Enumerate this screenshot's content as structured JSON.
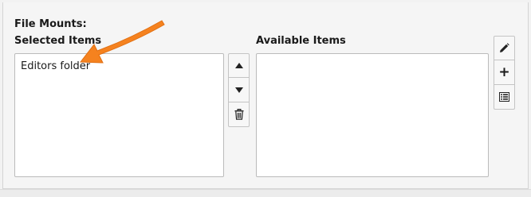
{
  "form": {
    "field_label": "File Mounts:",
    "selected_label": "Selected Items",
    "available_label": "Available Items"
  },
  "selected_items": [
    "Editors folder"
  ],
  "available_items": [],
  "icons": {
    "move_up": "triangle-up-icon",
    "move_down": "triangle-down-icon",
    "delete": "trash-icon",
    "edit": "pencil-icon",
    "add": "plus-icon",
    "list": "list-icon"
  },
  "colors": {
    "annotation_arrow": "#f5821f",
    "panel_bg": "#f5f5f5",
    "list_border": "#bbbbbb"
  }
}
